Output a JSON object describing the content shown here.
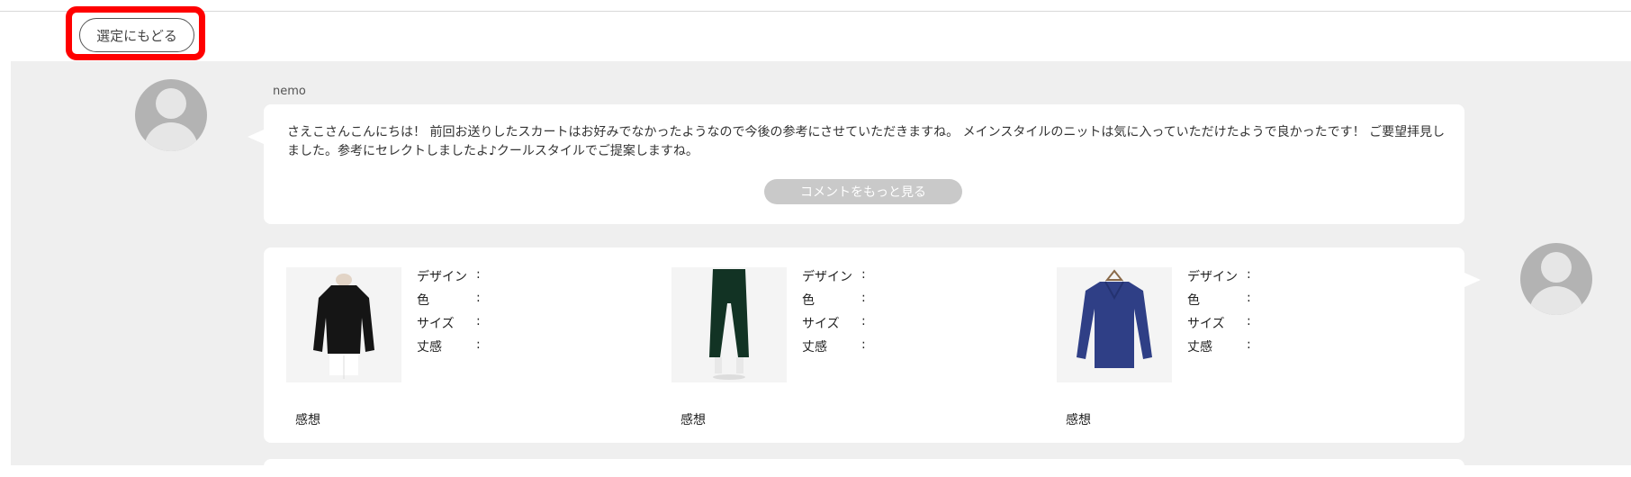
{
  "toolbar": {
    "back_label": "選定にもどる"
  },
  "stylist_comment": {
    "username": "nemo",
    "text": "さえこさんこんにちは！ 前回お送りしたスカートはお好みでなかったようなので今後の参考にさせていただきますね。 メインスタイルのニットは気に入っていただけたようで良かったです！ ご要望拝見しました。参考にセレクトしましたよ♪クールスタイルでご提案しますね。",
    "more_label": "コメントをもっと見る"
  },
  "feedback": {
    "items": [
      {
        "image_icon": "black-sweater-icon",
        "attributes": [
          {
            "label": "デザイン",
            "colon": ":",
            "value": ""
          },
          {
            "label": "色",
            "colon": ":",
            "value": ""
          },
          {
            "label": "サイズ",
            "colon": ":",
            "value": ""
          },
          {
            "label": "丈感",
            "colon": ":",
            "value": ""
          }
        ],
        "impression_label": "感想"
      },
      {
        "image_icon": "green-pants-icon",
        "attributes": [
          {
            "label": "デザイン",
            "colon": ":",
            "value": ""
          },
          {
            "label": "色",
            "colon": ":",
            "value": ""
          },
          {
            "label": "サイズ",
            "colon": ":",
            "value": ""
          },
          {
            "label": "丈感",
            "colon": ":",
            "value": ""
          }
        ],
        "impression_label": "感想"
      },
      {
        "image_icon": "navy-sweater-icon",
        "attributes": [
          {
            "label": "デザイン",
            "colon": ":",
            "value": ""
          },
          {
            "label": "色",
            "colon": ":",
            "value": ""
          },
          {
            "label": "サイズ",
            "colon": ":",
            "value": ""
          },
          {
            "label": "丈感",
            "colon": ":",
            "value": ""
          }
        ],
        "impression_label": "感想"
      }
    ]
  },
  "colors": {
    "highlight": "#ff0000",
    "feed_background": "#efefef",
    "avatar": "#b3b3b3",
    "more_button": "#c9c9c9"
  }
}
